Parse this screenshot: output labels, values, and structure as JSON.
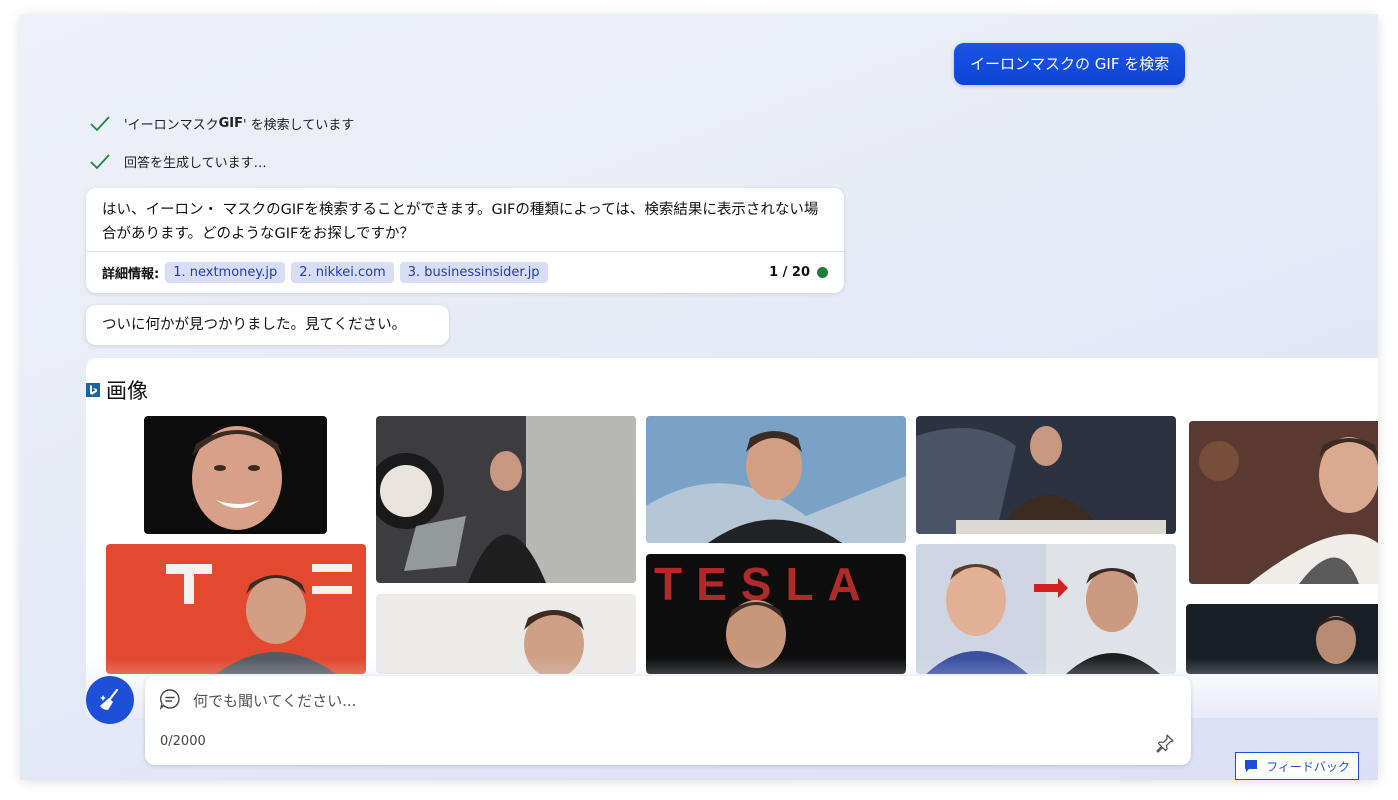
{
  "user_message": "イーロンマスクの GIF を検索",
  "progress": [
    {
      "pre": "'イーロンマスク ",
      "bold": "GIF",
      "post": "' を検索しています"
    },
    {
      "pre": "回答を生成しています…",
      "bold": "",
      "post": ""
    }
  ],
  "answer": {
    "text": "はい、イーロン・ マスクのGIFを検索することができます。GIFの種類によっては、検索結果に表示されない場合があります。どのようなGIFをお探しですか？",
    "details_label": "詳細情報:",
    "citations": [
      "1. nextmoney.jp",
      "2. nikkei.com",
      "3. businessinsider.jp"
    ],
    "page_count": "1 / 20"
  },
  "found_message": "ついに何かが見つかりました。見てください。",
  "images": {
    "title": "画像"
  },
  "input": {
    "placeholder": "何でも聞いてください...",
    "char_count": "0/2000"
  },
  "feedback_label": "フィードバック",
  "colors": {
    "accent": "#1d4fd8",
    "status_dot": "#1e7d3c",
    "citation_bg": "#d8def7"
  }
}
